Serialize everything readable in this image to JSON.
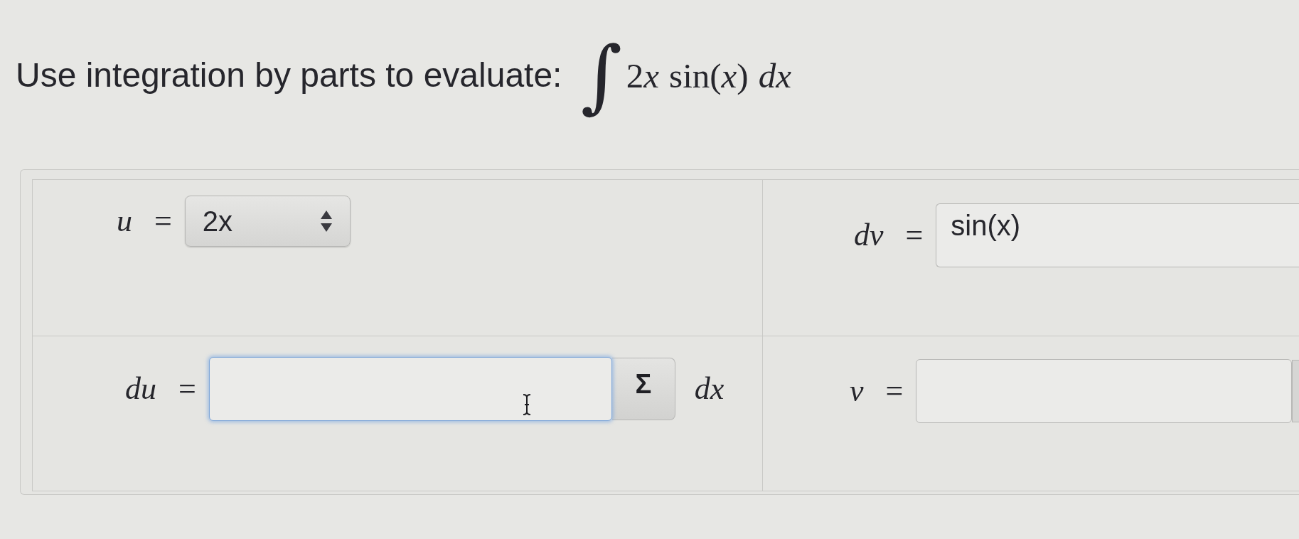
{
  "question": {
    "prompt": "Use integration by parts to evaluate:",
    "integral_sign": "∫",
    "integrand": {
      "coefficient": "2",
      "variable": "x",
      "function": "sin(*x*)",
      "differential": "dx"
    }
  },
  "grid": {
    "rows": [
      {
        "cells": [
          {
            "label": "*u* =",
            "control": {
              "kind": "select",
              "value": "2x",
              "focused": false
            }
          },
          {
            "label": "*dv* =",
            "control": {
              "kind": "text",
              "value": "sin(x)",
              "focused": false,
              "clipped": true
            }
          }
        ]
      },
      {
        "cells": [
          {
            "label": "*du* =",
            "control": {
              "kind": "text",
              "focused": true,
              "clipped": false,
              "symbol_button": {
                "label": "Σ",
                "clipped": false
              }
            },
            "suffix": "dx"
          },
          {
            "label": "*v* =",
            "control": {
              "kind": "text",
              "focused": false,
              "clipped": false,
              "symbol_button": {
                "clipped": true
              }
            }
          }
        ]
      }
    ]
  }
}
